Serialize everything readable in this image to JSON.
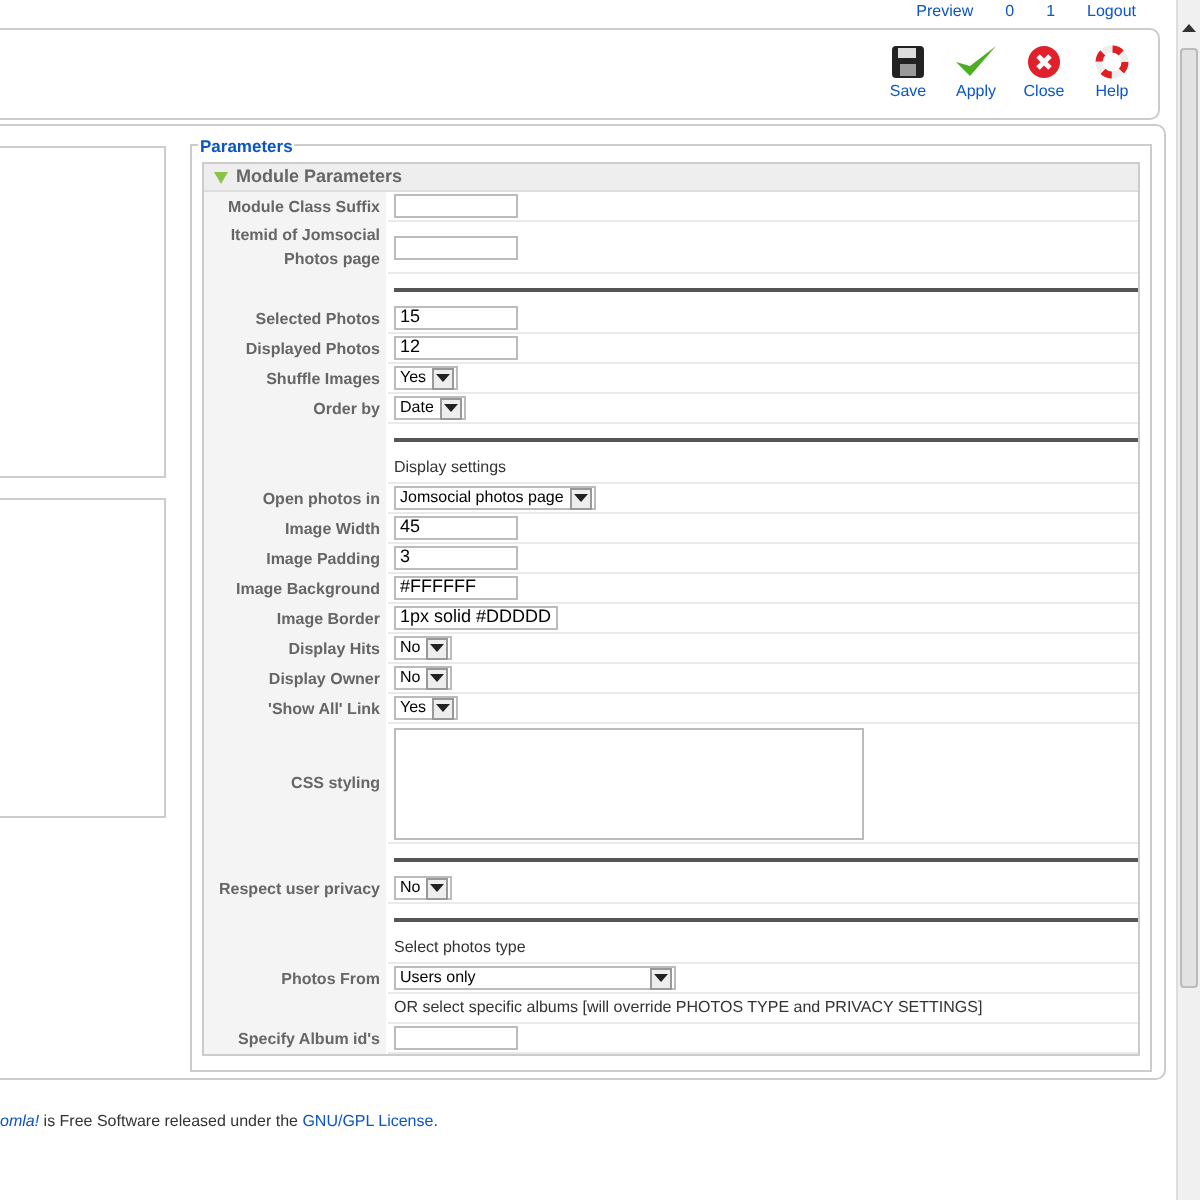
{
  "top_bar": {
    "items": [
      "Preview",
      "0",
      "1",
      "Logout"
    ]
  },
  "toolbar": {
    "buttons": [
      {
        "kind": "save",
        "label": "Save"
      },
      {
        "kind": "apply",
        "label": "Apply"
      },
      {
        "kind": "close",
        "label": "Close"
      },
      {
        "kind": "help",
        "label": "Help"
      }
    ]
  },
  "parameters": {
    "legend": "Parameters",
    "section_title": "Module Parameters",
    "expanded": true,
    "rows": [
      {
        "kind": "text",
        "label": "Module Class Suffix",
        "value": ""
      },
      {
        "kind": "text",
        "label": "Itemid of Jomsocial Photos page",
        "value": ""
      },
      {
        "kind": "rule"
      },
      {
        "kind": "text",
        "label": "Selected Photos",
        "value": "15"
      },
      {
        "kind": "text",
        "label": "Displayed Photos",
        "value": "12"
      },
      {
        "kind": "select",
        "label": "Shuffle Images",
        "value": "Yes"
      },
      {
        "kind": "select",
        "label": "Order by",
        "value": "Date"
      },
      {
        "kind": "rule"
      },
      {
        "kind": "note",
        "text": "Display settings"
      },
      {
        "kind": "select",
        "label": "Open photos in",
        "value": "Jomsocial photos page"
      },
      {
        "kind": "text",
        "label": "Image Width",
        "value": "45"
      },
      {
        "kind": "text",
        "label": "Image Padding",
        "value": "3"
      },
      {
        "kind": "text",
        "label": "Image Background",
        "value": "#FFFFFF"
      },
      {
        "kind": "text",
        "label": "Image Border",
        "value": "1px solid #DDDDD"
      },
      {
        "kind": "select",
        "label": "Display Hits",
        "value": "No"
      },
      {
        "kind": "select",
        "label": "Display Owner",
        "value": "No"
      },
      {
        "kind": "select",
        "label": "'Show All' Link",
        "value": "Yes"
      },
      {
        "kind": "textarea",
        "label": "CSS styling",
        "value": ""
      },
      {
        "kind": "rule"
      },
      {
        "kind": "select",
        "label": "Respect user privacy",
        "value": "No"
      },
      {
        "kind": "rule"
      },
      {
        "kind": "note",
        "text": "Select photos type"
      },
      {
        "kind": "wideselect",
        "label": "Photos From",
        "value": "Users only"
      },
      {
        "kind": "note",
        "text": "OR select specific albums [will override PHOTOS TYPE and PRIVACY SETTINGS]"
      },
      {
        "kind": "text",
        "label": "Specify Album id's",
        "value": ""
      }
    ]
  },
  "footer": {
    "link": "omla!",
    "text": " is Free Software released under the ",
    "license_link": "GNU/GPL License",
    "end": "."
  }
}
